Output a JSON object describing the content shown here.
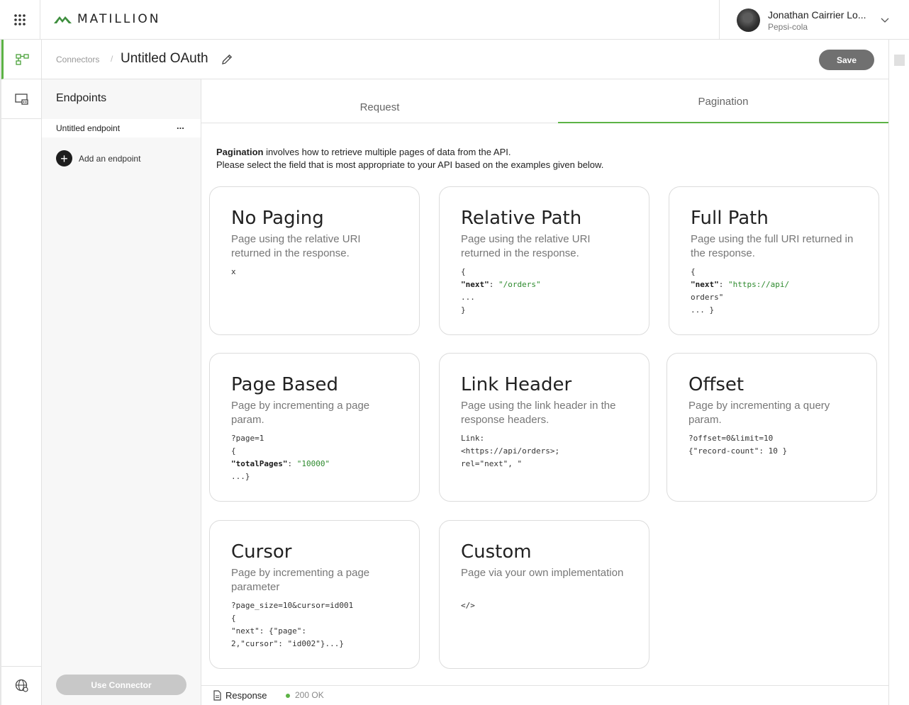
{
  "topbar": {
    "apps_icon": "grid-dots-icon",
    "logo_text": "MATILLION",
    "user_name": "Jonathan Cairrier Lo...",
    "user_org": "Pepsi-cola"
  },
  "rail": {
    "items": [
      {
        "icon": "connector-flow-icon",
        "active": true
      },
      {
        "icon": "monitor-icon",
        "active": false
      }
    ],
    "bottom_icon": "globe-icon"
  },
  "header": {
    "breadcrumb": "Connectors",
    "separator": "/",
    "title": "Untitled OAuth",
    "save_label": "Save"
  },
  "endpoints": {
    "title": "Endpoints",
    "items": [
      {
        "label": "Untitled endpoint",
        "more": "..."
      }
    ],
    "add_label": "Add an endpoint",
    "use_label": "Use Connector"
  },
  "tabs": [
    {
      "label": "Request",
      "active": false
    },
    {
      "label": "Pagination",
      "active": true
    }
  ],
  "intro": {
    "bold": "Pagination",
    "line1": " involves how to retrieve multiple pages of data from the API.",
    "line2": "Please select the field that is most appropriate to your API based on the examples given below."
  },
  "cards": [
    {
      "title": "No Paging",
      "desc": "Page using the relative URI returned in the response.",
      "code": "x"
    },
    {
      "title": "Relative Path",
      "desc": "Page using the relative URI returned in the response.",
      "code": "{\n\"next\": \"/orders\"\n...\n}"
    },
    {
      "title": "Full Path",
      "desc": "Page using the full URI returned in the response.",
      "code": "{\n\"next\": \"https://api/\norders\"\n... }"
    },
    {
      "title": "Page Based",
      "desc": "Page by incrementing a page param.",
      "code": "?page=1\n{\n\"totalPages\": \"10000\"\n...}"
    },
    {
      "title": "Link Header",
      "desc": "Page using the link header in the response headers.",
      "code": "Link:\n<https://api/orders>;\nrel=\"next\", \""
    },
    {
      "title": "Offset",
      "desc": "Page by incrementing a query param.",
      "code": "?offset=0&limit=10\n{\"record-count\": 10 }"
    },
    {
      "title": "Cursor",
      "desc": "Page by incrementing a page parameter",
      "code": "?page_size=10&cursor=id001\n{\n\"next\": {\"page\":\n2,\"cursor\": \"id002\"}...}"
    },
    {
      "title": "Custom",
      "desc": "Page via your own implementation",
      "code": "</>"
    }
  ],
  "status": {
    "response_label": "Response",
    "status_text": "200 OK",
    "status_color": "#5cb345"
  },
  "colors": {
    "accent": "#5cb345",
    "save_button": "#707070",
    "use_button": "#c8c8c8"
  }
}
